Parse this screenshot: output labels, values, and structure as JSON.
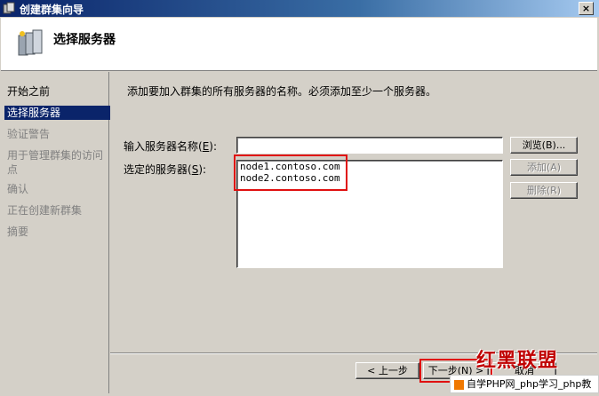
{
  "window": {
    "title": "创建群集向导",
    "close_label": "×"
  },
  "header": {
    "title": "选择服务器"
  },
  "sidebar": {
    "items": [
      {
        "label": "开始之前",
        "state": "done"
      },
      {
        "label": "选择服务器",
        "state": "active"
      },
      {
        "label": "验证警告",
        "state": "pending"
      },
      {
        "label": "用于管理群集的访问",
        "label2": "点",
        "state": "pending"
      },
      {
        "label": "确认",
        "state": "pending"
      },
      {
        "label": "正在创建新群集",
        "state": "pending"
      },
      {
        "label": "摘要",
        "state": "pending"
      }
    ]
  },
  "main": {
    "prompt": "添加要加入群集的所有服务器的名称。必须添加至少一个服务器。",
    "server_name_label": "输入服务器名称",
    "server_name_key": "E",
    "server_name_value": "",
    "selected_label": "选定的服务器",
    "selected_key": "S",
    "selected_servers": [
      "node1.contoso.com",
      "node2.contoso.com"
    ],
    "browse_label": "浏览(B)...",
    "add_label": "添加(A)",
    "remove_label": "删除(R)"
  },
  "footer": {
    "back_label": "< 上一步",
    "next_label": "下一步(N) >",
    "cancel_label": "取消"
  },
  "watermark": {
    "text": "红黑联盟",
    "banner": "自学PHP网_php学习_php教"
  },
  "colors": {
    "accent": "#0a246a",
    "highlight_box": "#e01010",
    "window_bg": "#d4d0c8"
  }
}
